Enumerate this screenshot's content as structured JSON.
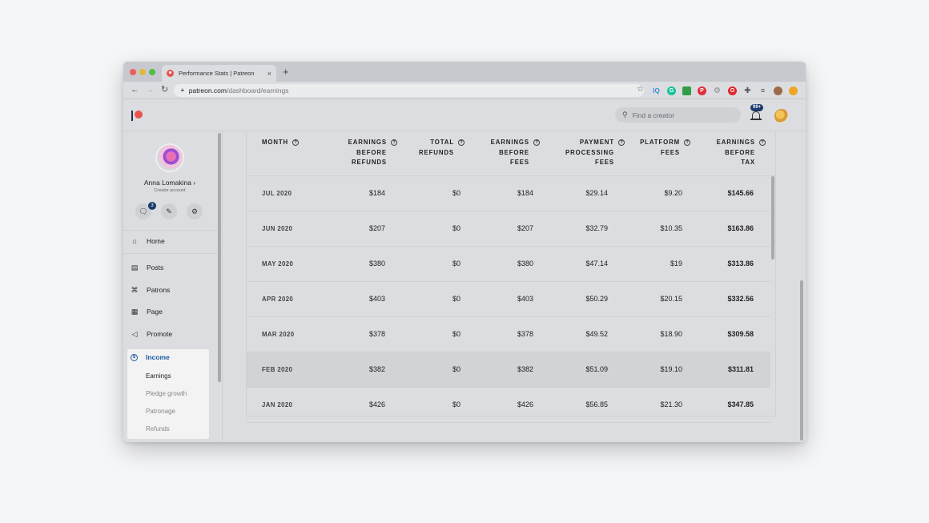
{
  "browser": {
    "tab_title": "Performance Stats | Patreon",
    "tab_close": "×",
    "new_tab": "+",
    "url_host": "patreon.com",
    "url_path": "/dashboard/earnings",
    "extensions": [
      "IQ",
      "G",
      "",
      "P",
      "",
      "O",
      "",
      "",
      "",
      ""
    ]
  },
  "header": {
    "search_placeholder": "Find a creator",
    "notification_badge": "99+"
  },
  "sidebar": {
    "name": "Anna Lomakina ›",
    "subtitle": "Creator account",
    "message_badge": "3",
    "nav": [
      {
        "label": "Home"
      },
      {
        "label": "Posts"
      },
      {
        "label": "Patrons"
      },
      {
        "label": "Page"
      },
      {
        "label": "Promote"
      }
    ],
    "income": {
      "label": "Income",
      "items": [
        "Earnings",
        "Pledge growth",
        "Patronage",
        "Refunds"
      ]
    }
  },
  "table": {
    "columns": [
      {
        "line1": "MONTH",
        "line2": "",
        "line3": ""
      },
      {
        "line1": "EARNINGS",
        "line2": "BEFORE",
        "line3": "REFUNDS"
      },
      {
        "line1": "TOTAL",
        "line2": "REFUNDS",
        "line3": ""
      },
      {
        "line1": "EARNINGS",
        "line2": "BEFORE",
        "line3": "FEES"
      },
      {
        "line1": "PAYMENT",
        "line2": "PROCESSING",
        "line3": "FEES"
      },
      {
        "line1": "PLATFORM",
        "line2": "FEES",
        "line3": ""
      },
      {
        "line1": "EARNINGS",
        "line2": "BEFORE",
        "line3": "TAX"
      }
    ],
    "help_glyph": "?",
    "rows": [
      {
        "month": "JUL 2020",
        "before_refunds": "$184",
        "refunds": "$0",
        "before_fees": "$184",
        "processing": "$29.14",
        "platform": "$9.20",
        "before_tax": "$145.66"
      },
      {
        "month": "JUN 2020",
        "before_refunds": "$207",
        "refunds": "$0",
        "before_fees": "$207",
        "processing": "$32.79",
        "platform": "$10.35",
        "before_tax": "$163.86"
      },
      {
        "month": "MAY 2020",
        "before_refunds": "$380",
        "refunds": "$0",
        "before_fees": "$380",
        "processing": "$47.14",
        "platform": "$19",
        "before_tax": "$313.86"
      },
      {
        "month": "APR 2020",
        "before_refunds": "$403",
        "refunds": "$0",
        "before_fees": "$403",
        "processing": "$50.29",
        "platform": "$20.15",
        "before_tax": "$332.56"
      },
      {
        "month": "MAR 2020",
        "before_refunds": "$378",
        "refunds": "$0",
        "before_fees": "$378",
        "processing": "$49.52",
        "platform": "$18.90",
        "before_tax": "$309.58"
      },
      {
        "month": "FEB 2020",
        "before_refunds": "$382",
        "refunds": "$0",
        "before_fees": "$382",
        "processing": "$51.09",
        "platform": "$19.10",
        "before_tax": "$311.81"
      },
      {
        "month": "JAN 2020",
        "before_refunds": "$426",
        "refunds": "$0",
        "before_fees": "$426",
        "processing": "$56.85",
        "platform": "$21.30",
        "before_tax": "$347.85"
      }
    ]
  }
}
